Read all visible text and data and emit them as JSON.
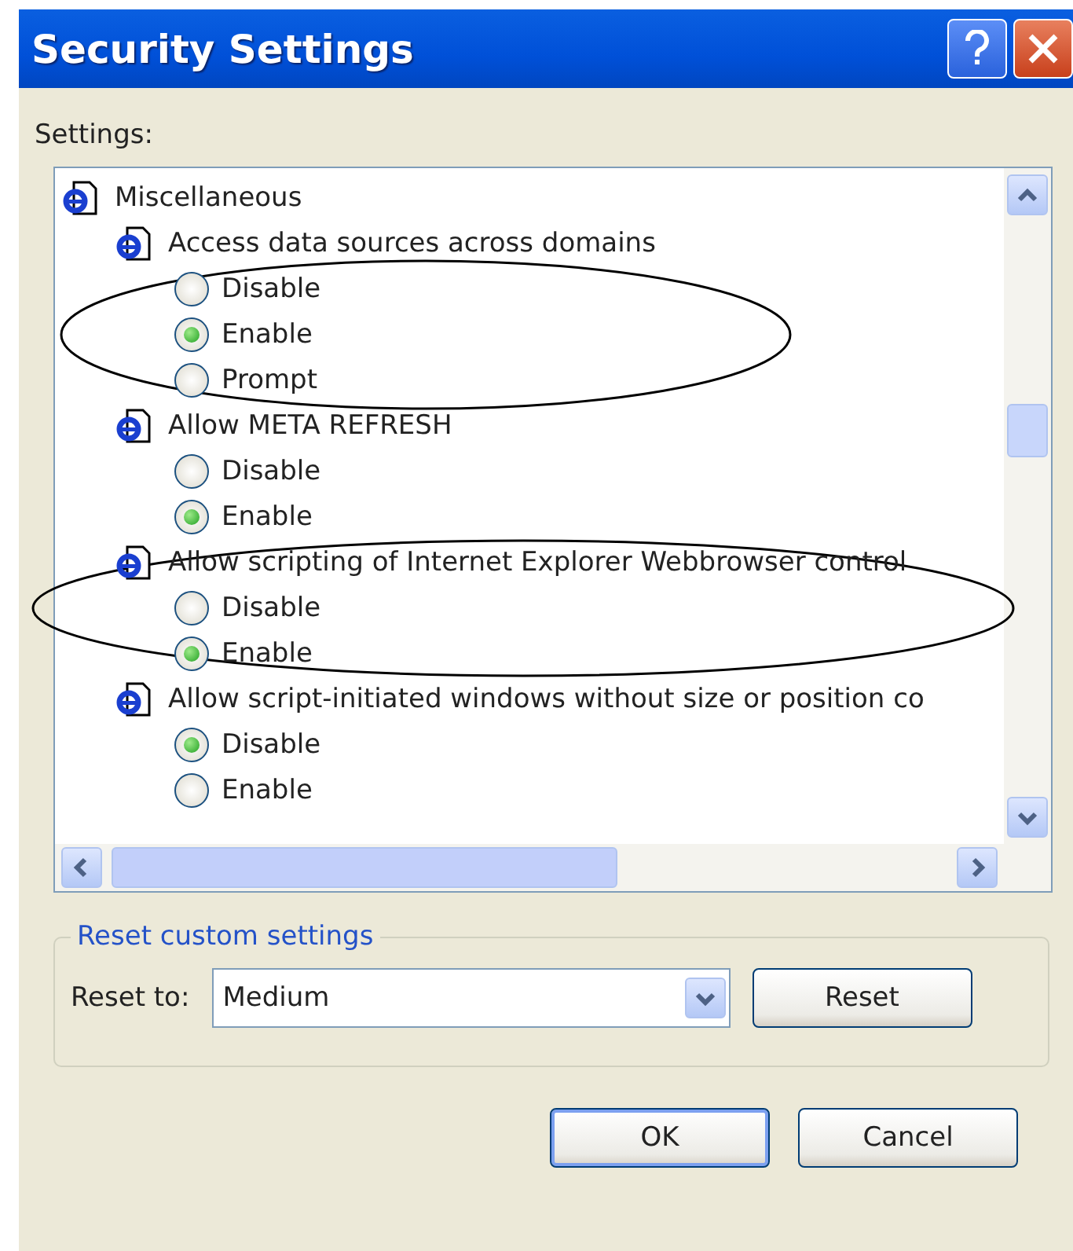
{
  "window": {
    "title": "Security Settings"
  },
  "settings_label": "Settings:",
  "tree": [
    {
      "label": "Miscellaneous",
      "children": [
        {
          "label": "Access data sources across domains",
          "options": [
            {
              "label": "Disable",
              "selected": false
            },
            {
              "label": "Enable",
              "selected": true
            },
            {
              "label": "Prompt",
              "selected": false
            }
          ]
        },
        {
          "label": "Allow META REFRESH",
          "options": [
            {
              "label": "Disable",
              "selected": false
            },
            {
              "label": "Enable",
              "selected": true
            }
          ]
        },
        {
          "label": "Allow scripting of Internet Explorer Webbrowser control",
          "options": [
            {
              "label": "Disable",
              "selected": false
            },
            {
              "label": "Enable",
              "selected": true
            }
          ]
        },
        {
          "label": "Allow script-initiated windows without size or position co",
          "options": [
            {
              "label": "Disable",
              "selected": true
            },
            {
              "label": "Enable",
              "selected": false
            }
          ]
        }
      ]
    }
  ],
  "reset_group": {
    "title": "Reset custom settings",
    "label": "Reset to:",
    "value": "Medium",
    "button": "Reset"
  },
  "buttons": [
    "OK",
    "Cancel"
  ]
}
